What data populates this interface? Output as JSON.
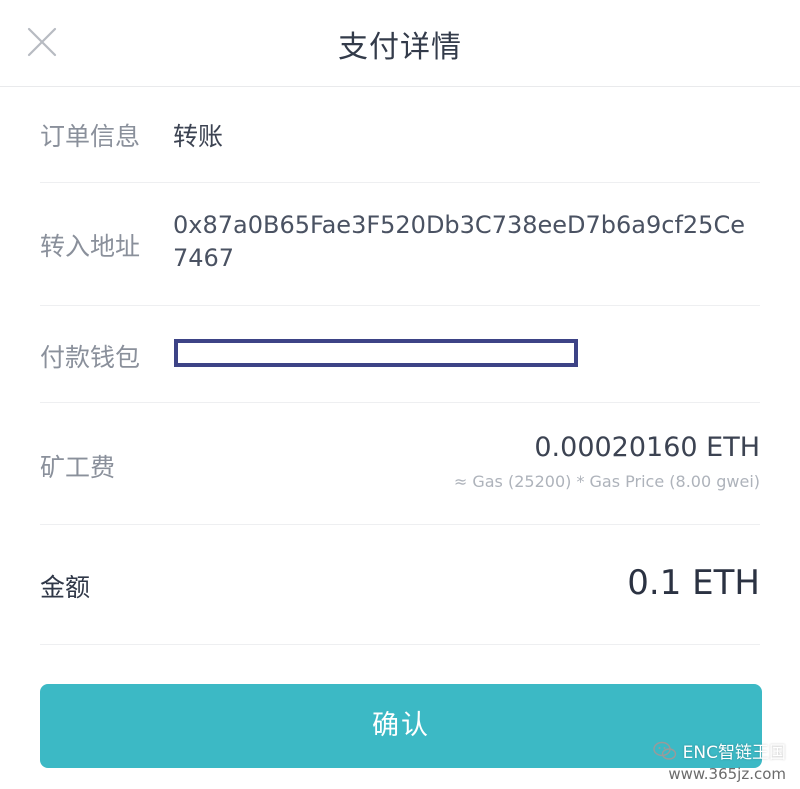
{
  "header": {
    "title": "支付详情",
    "close_icon": "close-icon"
  },
  "rows": {
    "order": {
      "label": "订单信息",
      "value": "转账"
    },
    "address": {
      "label": "转入地址",
      "value": "0x87a0B65Fae3F520Db3C738eeD7b6a9cf25Ce7467"
    },
    "wallet": {
      "label": "付款钱包"
    },
    "fee": {
      "label": "矿工费",
      "amount": "0.00020160 ETH",
      "detail": "≈ Gas (25200) * Gas Price (8.00 gwei)"
    },
    "amount": {
      "label": "金额",
      "value": "0.1 ETH"
    }
  },
  "confirm": {
    "label": "确认"
  },
  "watermark": {
    "line1": "ENC智链王国",
    "line2": "www.365jz.com"
  },
  "colors": {
    "accent": "#3cb9c5",
    "wallet_box_border": "#3d4386",
    "label_gray": "#8a909b",
    "text_dark": "#2f3747"
  }
}
